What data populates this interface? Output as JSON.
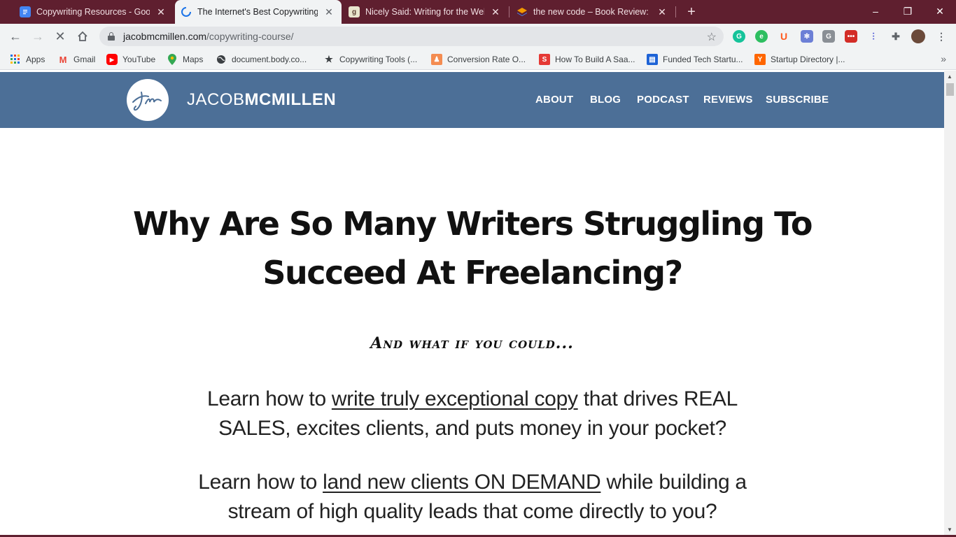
{
  "tabs": [
    {
      "title": "Copywriting Resources - Google",
      "favicon_color": "#4285f4",
      "favicon_icon": "docs-icon"
    },
    {
      "title": "The Internet's Best Copywriting C",
      "favicon_color": "#1a73e8",
      "favicon_icon": "loading-icon"
    },
    {
      "title": "Nicely Said: Writing for the Web w",
      "favicon_color": "#8d6e63",
      "favicon_icon": "goodreads-icon"
    },
    {
      "title": "the new code – Book Review: Nic",
      "favicon_color": "#f29900",
      "favicon_icon": "stack-icon"
    }
  ],
  "address": {
    "domain": "jacobmcmillen.com",
    "path": "/copywriting-course/"
  },
  "bookmarks": [
    {
      "label": "Apps",
      "icon": "apps-grid-icon"
    },
    {
      "label": "Gmail",
      "icon": "gmail-icon"
    },
    {
      "label": "YouTube",
      "icon": "youtube-icon"
    },
    {
      "label": "Maps",
      "icon": "maps-icon"
    },
    {
      "label": "document.body.co...",
      "icon": "globe-icon"
    },
    {
      "label": "Copywriting Tools (...",
      "icon": "star-icon"
    },
    {
      "label": "Conversion Rate O...",
      "icon": "conversion-icon"
    },
    {
      "label": "How To Build A Saa...",
      "icon": "saas-icon"
    },
    {
      "label": "Funded Tech Startu...",
      "icon": "startup-icon"
    },
    {
      "label": "Startup Directory |...",
      "icon": "ycombinator-icon"
    }
  ],
  "site": {
    "logo_light": "JACOB",
    "logo_bold": "MCMILLEN",
    "nav": [
      "ABOUT",
      "BLOG",
      "PODCAST",
      "REVIEWS",
      "SUBSCRIBE"
    ],
    "headline": "Why Are So Many Writers Struggling To Succeed At Freelancing?",
    "subhead": "And what if you could...",
    "para1": {
      "before": "Learn how to ",
      "link": "write truly exceptional copy",
      "after": " that drives REAL SALES, excites clients, and puts money in your pocket?"
    },
    "para2": {
      "before": "Learn how to ",
      "link": "land new clients ON DEMAND",
      "after": " while building a stream of high quality leads that come directly to you?"
    }
  },
  "colors": {
    "tabstrip": "#5f1f2f",
    "header": "#4c6f97"
  }
}
